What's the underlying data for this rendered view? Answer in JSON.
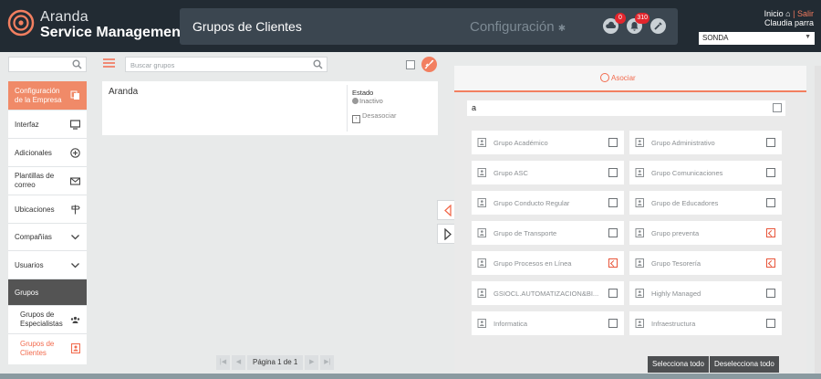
{
  "brand": {
    "line1": "Aranda",
    "line2": "Service Management"
  },
  "header": {
    "title": "Grupos de Clientes",
    "config_label": "Configuración",
    "notifications": [
      {
        "icon": "cloud-icon",
        "badge": "0"
      },
      {
        "icon": "bell-icon",
        "badge": "310"
      },
      {
        "icon": "tools-icon",
        "badge": ""
      }
    ],
    "inicio": "Inicio",
    "separator": "|",
    "salir": "Salir",
    "user": "Claudia parra",
    "company_select": "SONDA"
  },
  "sidebar": {
    "items": [
      {
        "label": "Configuración de la Empresa",
        "icon": "copy-icon"
      },
      {
        "label": "Interfaz",
        "icon": "monitor-icon"
      },
      {
        "label": "Adicionales",
        "icon": "plus-circle-icon"
      },
      {
        "label": "Plantillas de correo",
        "icon": "mail-icon"
      },
      {
        "label": "Ubicaciones",
        "icon": "signpost-icon"
      },
      {
        "label": "Compañías",
        "icon": "chevron-down-icon"
      },
      {
        "label": "Usuarios",
        "icon": "chevron-down-icon"
      },
      {
        "label": "Grupos",
        "icon": ""
      },
      {
        "label": "Grupos de Especialistas",
        "icon": "people-icon"
      },
      {
        "label": "Grupos de Clientes",
        "icon": "contacts-icon"
      }
    ]
  },
  "middle": {
    "search_placeholder": "Buscar grupos",
    "card": {
      "name": "Aranda",
      "estado_label": "Estado",
      "estado_value": "Inactivo",
      "action": "Desasociar"
    },
    "pager": {
      "label": "Página 1 de 1"
    }
  },
  "right": {
    "tab_label": "Asociar",
    "filter_value": "a",
    "groups": [
      {
        "label": "Grupo Académico",
        "checked": false
      },
      {
        "label": "Grupo Administrativo",
        "checked": false
      },
      {
        "label": "Grupo ASC",
        "checked": false
      },
      {
        "label": "Grupo Comunicaciones",
        "checked": false
      },
      {
        "label": "Grupo Conducto Regular",
        "checked": false
      },
      {
        "label": "Grupo de Educadores",
        "checked": false
      },
      {
        "label": "Grupo de Transporte",
        "checked": false
      },
      {
        "label": "Grupo preventa",
        "checked": true
      },
      {
        "label": "Grupo Procesos en Línea",
        "checked": true
      },
      {
        "label": "Grupo Tesorería",
        "checked": true
      },
      {
        "label": "GSIOCL.AUTOMATIZACION&BI...",
        "checked": false
      },
      {
        "label": "Highly Managed",
        "checked": false
      },
      {
        "label": "Informatica",
        "checked": false
      },
      {
        "label": "Infraestructura",
        "checked": false
      }
    ],
    "select_all": "Selecciona todo",
    "deselect_all": "Deselecciona todo"
  },
  "colors": {
    "accent": "#f27f60",
    "header_bg": "#222b33",
    "dark_btn": "#4d4f51"
  }
}
